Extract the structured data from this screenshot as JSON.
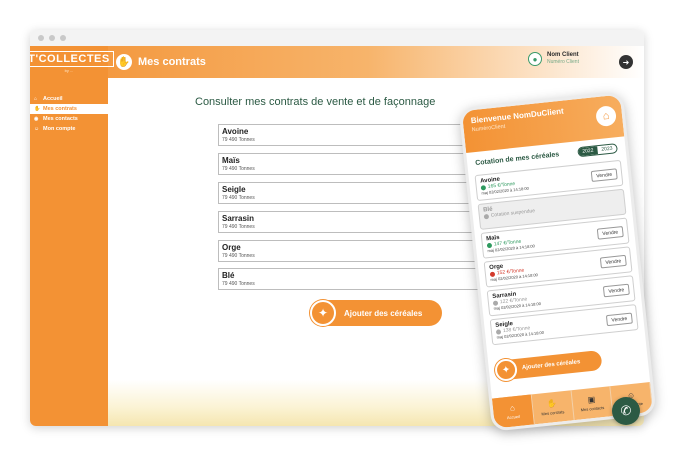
{
  "app": {
    "logo_text": "T'COLLECTES",
    "logo_sub": "by ...",
    "title": "Mes contrats"
  },
  "user": {
    "name": "Nom Client",
    "sub": "Numéro Client"
  },
  "sidebar": {
    "items": [
      {
        "label": "Accueil",
        "active": false
      },
      {
        "label": "Mes contrats",
        "active": true
      },
      {
        "label": "Mes contacts",
        "active": false
      },
      {
        "label": "Mon compte",
        "active": false
      }
    ]
  },
  "main": {
    "heading": "Consulter mes contrats de vente et de façonnage",
    "contracts": [
      {
        "name": "Avoine",
        "qty": "79 490 Tonnes"
      },
      {
        "name": "Maïs",
        "qty": "79 490 Tonnes"
      },
      {
        "name": "Seigle",
        "qty": "79 490 Tonnes"
      },
      {
        "name": "Sarrasin",
        "qty": "79 490 Tonnes"
      },
      {
        "name": "Orge",
        "qty": "79 490 Tonnes"
      },
      {
        "name": "Blé",
        "qty": "79 490 Tonnes"
      }
    ],
    "add_label": "Ajouter des céréales"
  },
  "phone": {
    "welcome": "Bienvenue NomDuClient",
    "client": "NuméroClient",
    "section_title": "Cotation de mes céréales",
    "years": [
      "2022",
      "2023"
    ],
    "sell_label": "Vendre",
    "cereals": [
      {
        "name": "Avoine",
        "price": "165 €/Tonne",
        "date": "maj 02/02/2020 à 14:18:00",
        "trend": "up",
        "disabled": false
      },
      {
        "name": "Blé",
        "price": "Cotation suspendue",
        "date": "",
        "trend": "flat",
        "disabled": true
      },
      {
        "name": "Maïs",
        "price": "147 €/Tonne",
        "date": "maj 02/02/2020 à 14:18:00",
        "trend": "up",
        "disabled": false
      },
      {
        "name": "Orge",
        "price": "152 €/Tonne",
        "date": "maj 02/02/2020 à 14:18:00",
        "trend": "down",
        "disabled": false
      },
      {
        "name": "Sarrasin",
        "price": "122 €/Tonne",
        "date": "maj 02/02/2020 à 14:18:00",
        "trend": "flat",
        "disabled": false
      },
      {
        "name": "Seigle",
        "price": "138 €/Tonne",
        "date": "maj 02/02/2020 à 14:18:00",
        "trend": "flat",
        "disabled": false
      }
    ],
    "add_label": "Ajouter des céréales",
    "tabs": [
      {
        "label": "Accueil",
        "icon": "home-icon"
      },
      {
        "label": "Mes contrats",
        "icon": "handshake-icon"
      },
      {
        "label": "Mes contacts",
        "icon": "contact-icon"
      },
      {
        "label": "Mon compte",
        "icon": "account-icon"
      }
    ]
  },
  "colors": {
    "orange": "#f39234",
    "green": "#2c5a44",
    "up": "#2f9a5f",
    "down": "#d33a2c"
  }
}
